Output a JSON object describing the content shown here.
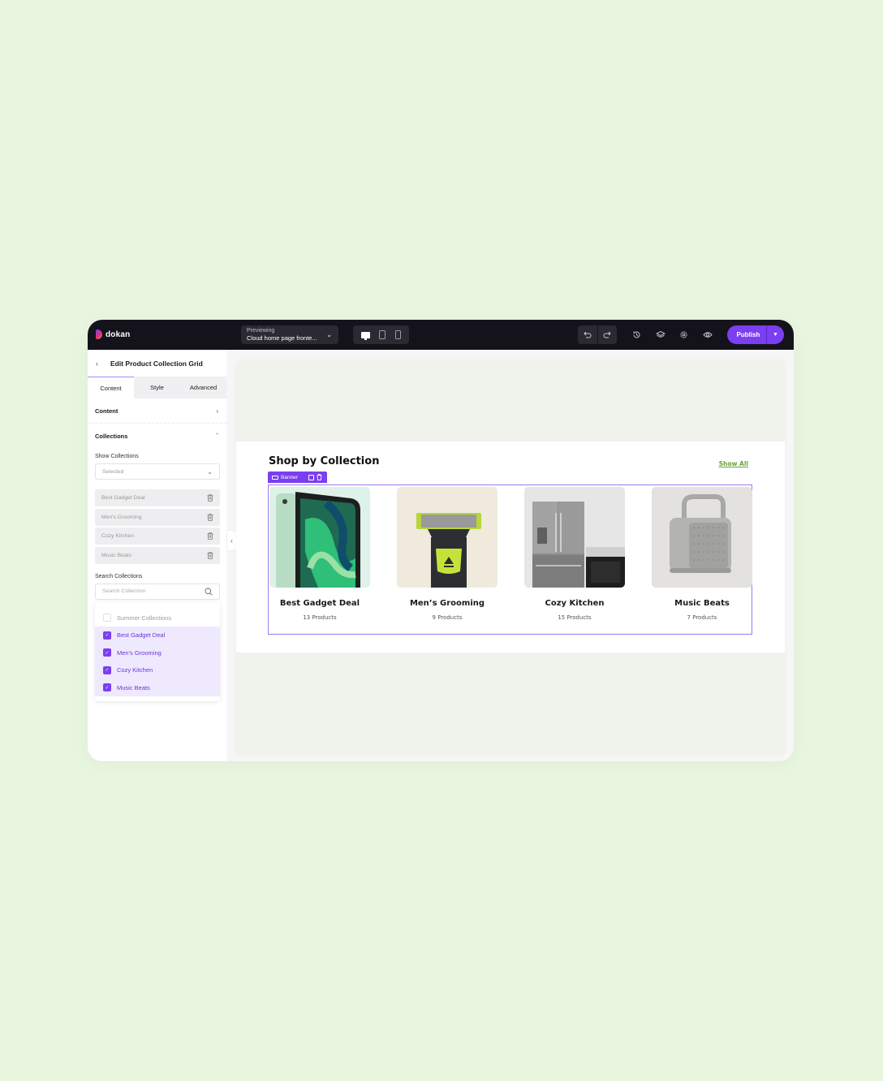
{
  "app": {
    "logo_text": "dokan",
    "preview": {
      "label": "Previewing",
      "value": "Cloud home page fronte..."
    },
    "devices": [
      "desktop",
      "tablet",
      "mobile"
    ],
    "active_device": "desktop",
    "toolbar_icons": [
      "undo-icon",
      "redo-icon",
      "history-icon",
      "layers-icon",
      "settings-icon",
      "preview-eye-icon"
    ],
    "publish_label": "Publish"
  },
  "sidebar": {
    "title": "Edit Product Collection Grid",
    "tabs": [
      {
        "label": "Content",
        "active": true
      },
      {
        "label": "Style",
        "active": false
      },
      {
        "label": "Advanced",
        "active": false
      }
    ],
    "sections": [
      {
        "label": "Content",
        "expanded": false
      },
      {
        "label": "Collections",
        "expanded": true
      }
    ],
    "show_collections": {
      "label": "Show Collections",
      "value": "Selected"
    },
    "selected_collections": [
      "Best Gadget Deal",
      "Men's Grooming",
      "Cozy Kitchen",
      "Music Beats"
    ],
    "search": {
      "label": "Search Collections",
      "placeholder": "Search Collection",
      "value": ""
    },
    "dropdown_options": [
      {
        "label": "Summer Collections",
        "checked": false
      },
      {
        "label": "Best Gadget Deal",
        "checked": true
      },
      {
        "label": "Men's Grooming",
        "checked": true
      },
      {
        "label": "Cozy Kitchen",
        "checked": true
      },
      {
        "label": "Music Beats",
        "checked": true
      }
    ]
  },
  "canvas": {
    "section_title": "Shop by Collection",
    "show_all": "Show All",
    "banner_tag": "Banner",
    "collections": [
      {
        "name": "Best Gadget Deal",
        "count": "13 Products",
        "image": "tablet-image"
      },
      {
        "name": "Men’s Grooming",
        "count": "9 Products",
        "image": "trimmer-image"
      },
      {
        "name": "Cozy Kitchen",
        "count": "15 Products",
        "image": "fridge-oven-image"
      },
      {
        "name": "Music Beats",
        "count": "7 Products",
        "image": "speaker-image"
      }
    ]
  },
  "colors": {
    "accent": "#7a3ff0",
    "link": "#6aa33c",
    "background": "#e8f6e0",
    "topbar": "#14131c"
  }
}
